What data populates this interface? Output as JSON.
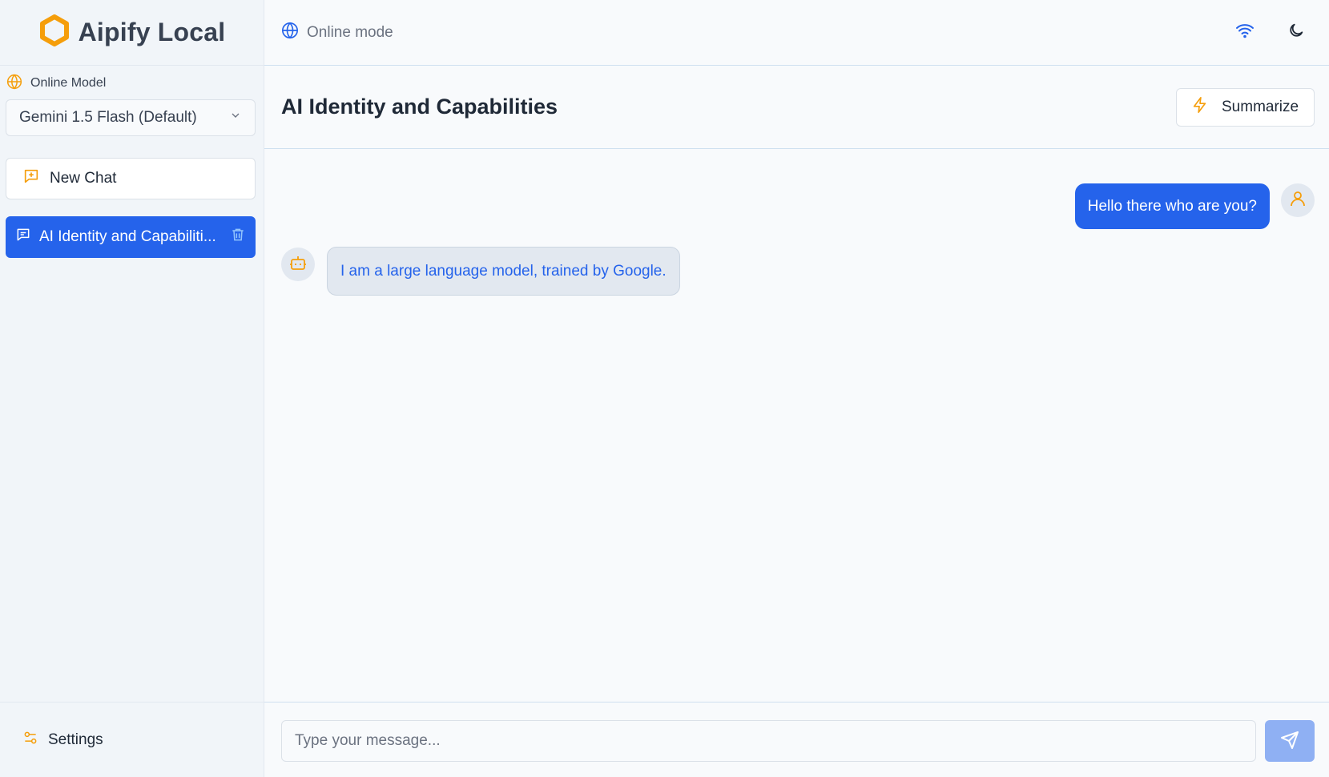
{
  "app": {
    "title": "Aipify Local"
  },
  "sidebar": {
    "model_label": "Online Model",
    "model_selected": "Gemini 1.5 Flash (Default)",
    "new_chat_label": "New Chat",
    "chats": [
      {
        "label": "AI Identity and Capabiliti..."
      }
    ],
    "settings_label": "Settings"
  },
  "topbar": {
    "mode_label": "Online mode"
  },
  "chat": {
    "title": "AI Identity and Capabilities",
    "summarize_label": "Summarize",
    "messages": [
      {
        "role": "user",
        "text": "Hello there who are you?"
      },
      {
        "role": "assistant",
        "text": "I am a large language model, trained by Google."
      }
    ]
  },
  "composer": {
    "placeholder": "Type your message..."
  },
  "colors": {
    "accent": "#2563eb",
    "brand_orange": "#f59e0b",
    "send_disabled": "#8fb0f3"
  },
  "icons": {
    "logo": "hexagon-icon",
    "model": "globe-icon",
    "select": "chevron-down-icon",
    "new_chat": "message-plus-icon",
    "chat_item": "message-icon",
    "delete": "trash-icon",
    "settings": "sliders-icon",
    "mode": "globe-icon",
    "wifi": "wifi-icon",
    "theme": "moon-icon",
    "summarize": "lightning-icon",
    "user": "user-icon",
    "bot": "bot-icon",
    "send": "send-icon"
  }
}
